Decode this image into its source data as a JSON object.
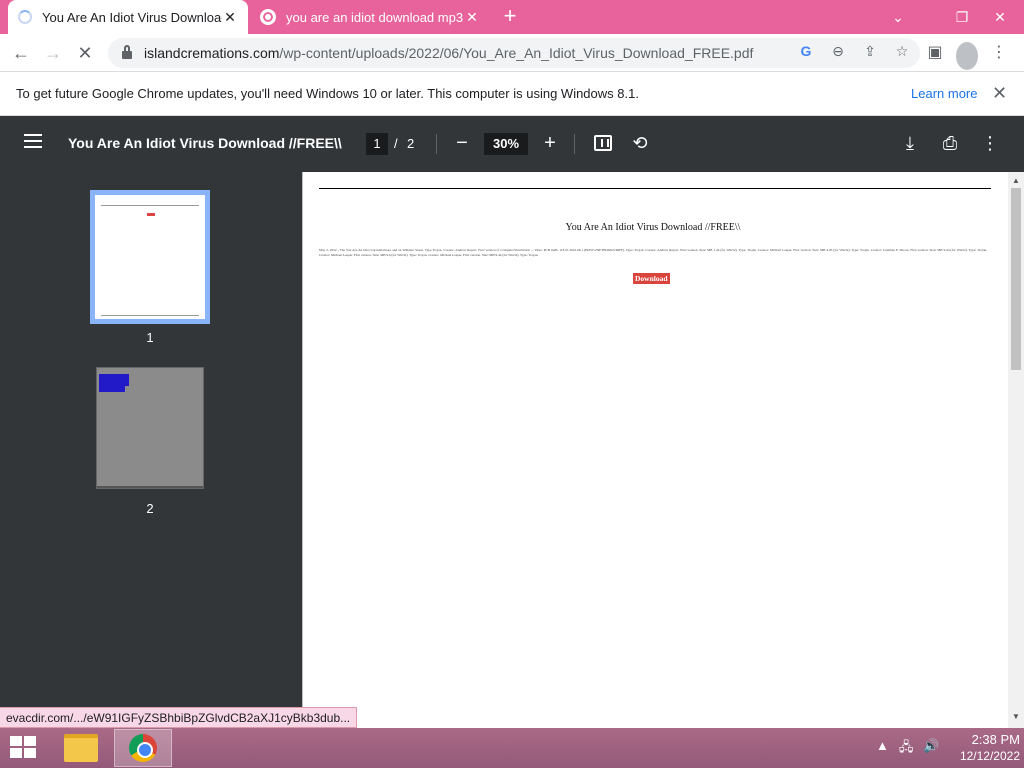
{
  "browser": {
    "tabs": [
      {
        "title": "You Are An Idiot Virus Download",
        "close": "✕",
        "state": "loading"
      },
      {
        "title": "you are an idiot download mp3",
        "close": "✕"
      }
    ],
    "new_tab": "+",
    "window_controls": {
      "dropdown": "⌄",
      "restore": "❐",
      "close": "✕"
    },
    "nav": {
      "back": "←",
      "forward": "→",
      "reload": "✕"
    },
    "url": {
      "host": "islandcremations.com",
      "path": "/wp-content/uploads/2022/06/You_Are_An_Idiot_Virus_Download_FREE.pdf"
    },
    "omnibox_icons": [
      "google-lens-icon",
      "zoom-icon",
      "share-icon",
      "bookmark-star-icon"
    ],
    "infobar": {
      "message": "To get future Google Chrome updates, you'll need Windows 10 or later. This computer is using Windows 8.1.",
      "link": "Learn more",
      "close": "✕"
    }
  },
  "pdf": {
    "title": "You Are An Idiot Virus Download //FREE\\\\",
    "current_page": "1",
    "separator": "/",
    "total_pages": "2",
    "zoom": "30%",
    "zoom_minus": "−",
    "zoom_plus": "+",
    "thumbnails": [
      {
        "label": "1"
      },
      {
        "label": "2"
      }
    ],
    "page": {
      "heading": "You Are An Idiot Virus Download //FREE\\\\",
      "body": "May 2, 2022 - The You Are An Idiot trojan/malware and on Whistler Street. Type Trojan. Creator: Andrew Report. First version of ComputerVirusWatch ... Virus: PCB 6AB. 118.21.2022.06.1 (HOST/2NETBOOKS/DIFF). Type: Trojan. Creator: Andrew Report. First version. Size: MB 1.44 (for Win32). Type: Trojan. Creator: Michael Leeper. First version. Size: MB 4.05 (for Win32). Type: Trojan. Creator: Jonathan F. Moore. First version. Size: MB 9.44 (for Win32). Type: Trojan. Creator: Michael Leeper. First version. Size: MB 9.6 (for Win32). Type: Trojan. Creator: Michael Leeper. First version. Size: MB 9.44 (for Win32). Type: Trojan.",
      "download": "Download"
    }
  },
  "status_link": "evacdir.com/.../eW91IGFyZSBhbiBpZGlvdCB2aXJ1cyBkb3dub...",
  "taskbar": {
    "time": "2:38 PM",
    "date": "12/12/2022",
    "tray": [
      "▲",
      "🖧",
      "🔊"
    ]
  },
  "colors": {
    "tabstrip": "#e8639b",
    "pdf_toolbar": "#323639",
    "download_button": "#d9453d",
    "thumbnail_selected": "#8ab4f8"
  }
}
